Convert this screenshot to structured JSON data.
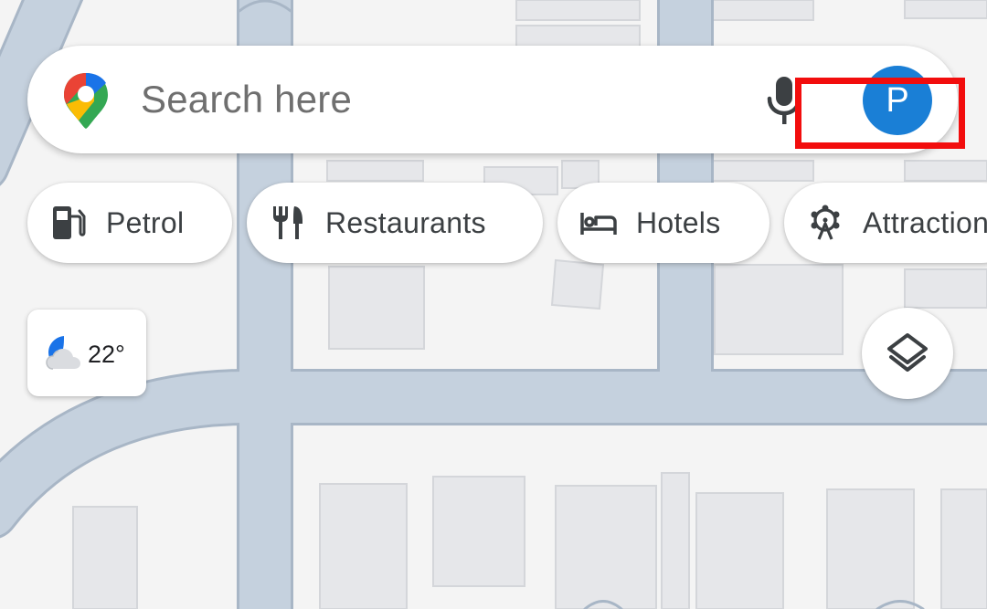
{
  "search": {
    "placeholder": "Search here"
  },
  "account": {
    "avatar_letter": "P",
    "avatar_color": "#1a7fd6",
    "highlight_color": "#f20d0d"
  },
  "chips": [
    {
      "label": "Petrol",
      "icon": "fuel-pump-icon"
    },
    {
      "label": "Restaurants",
      "icon": "fork-knife-icon"
    },
    {
      "label": "Hotels",
      "icon": "bed-icon"
    },
    {
      "label": "Attractions",
      "icon": "ferris-wheel-icon"
    }
  ],
  "weather": {
    "temperature": "22°",
    "icon": "partly-cloudy-night-icon"
  },
  "map": {
    "road_color": "#c5d1de",
    "background_color": "#f4f4f4",
    "building_color": "#e6e7ea"
  },
  "controls": {
    "layers_icon": "layers-icon"
  }
}
